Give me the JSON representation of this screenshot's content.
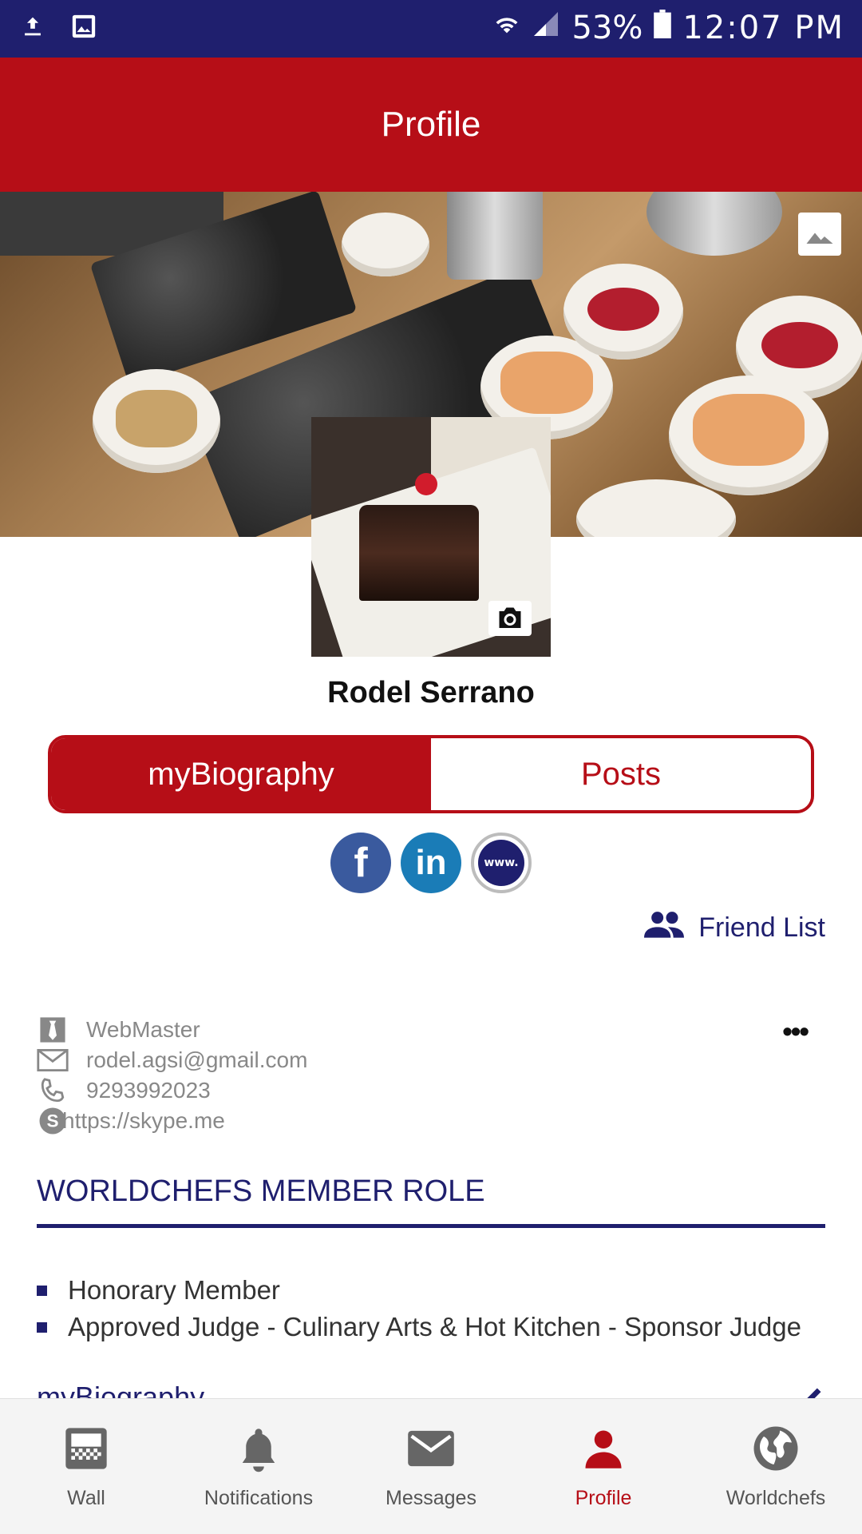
{
  "status_bar": {
    "battery": "53%",
    "time": "12:07 PM",
    "icons": [
      "upload-icon",
      "image-icon",
      "wifi-icon",
      "signal-icon",
      "battery-icon"
    ]
  },
  "header": {
    "title": "Profile"
  },
  "profile": {
    "name": "Rodel Serrano"
  },
  "tabs": [
    {
      "label": "myBiography",
      "active": true
    },
    {
      "label": "Posts",
      "active": false
    }
  ],
  "social": {
    "facebook": "f",
    "linkedin": "in",
    "website": "www."
  },
  "friend_list": {
    "label": "Friend List"
  },
  "contacts": {
    "role": "WebMaster",
    "email": "rodel.agsi@gmail.com",
    "phone": "9293992023",
    "skype": "https://skype.me"
  },
  "more_label": "•••",
  "member_role": {
    "title": "WORLDCHEFS MEMBER ROLE",
    "items": [
      "Honorary Member",
      "Approved Judge - Culinary Arts & Hot Kitchen - Sponsor Judge"
    ]
  },
  "bio_section": {
    "title": "myBiography"
  },
  "bottom_nav": [
    {
      "label": "Wall",
      "icon": "wall-icon",
      "active": false
    },
    {
      "label": "Notifications",
      "icon": "bell-icon",
      "active": false
    },
    {
      "label": "Messages",
      "icon": "mail-icon",
      "active": false
    },
    {
      "label": "Profile",
      "icon": "person-icon",
      "active": true
    },
    {
      "label": "Worldchefs",
      "icon": "globe-icon",
      "active": false
    }
  ],
  "colors": {
    "primary_red": "#b60e17",
    "navy": "#1f1f6e",
    "status_bar": "#1f1f6e"
  }
}
